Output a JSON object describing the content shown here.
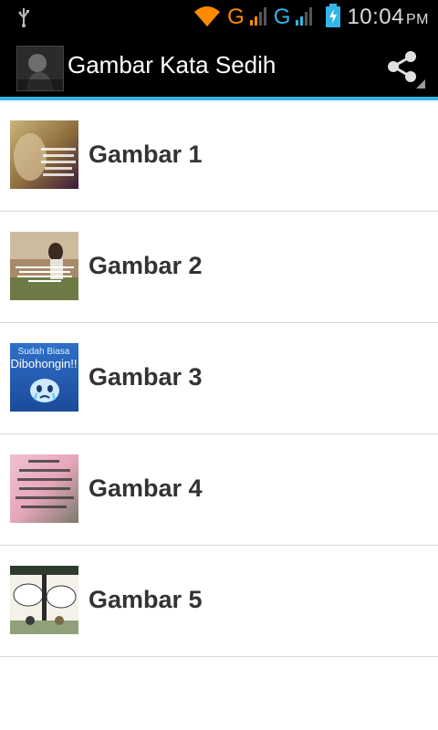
{
  "status_bar": {
    "icons": [
      "usb-icon",
      "wifi-icon",
      "signal-g-icon",
      "signal-g-icon",
      "battery-charging-icon"
    ],
    "net_label_1": "G",
    "net_label_2": "G",
    "time": "10:04",
    "ampm": "PM",
    "colors": {
      "wifi_active": "#ff8a00",
      "signal_active": "#ff8a00",
      "battery": "#33b5e5"
    }
  },
  "action_bar": {
    "title": "Gambar Kata Sedih",
    "share_icon": "share-icon",
    "accent": "#33b5e5"
  },
  "items": [
    {
      "label": "Gambar 1"
    },
    {
      "label": "Gambar 2"
    },
    {
      "label": "Gambar 3",
      "thumb_text_1": "Sudah Biasa",
      "thumb_text_2": "Dibohongin!!"
    },
    {
      "label": "Gambar 4"
    },
    {
      "label": "Gambar 5"
    }
  ]
}
